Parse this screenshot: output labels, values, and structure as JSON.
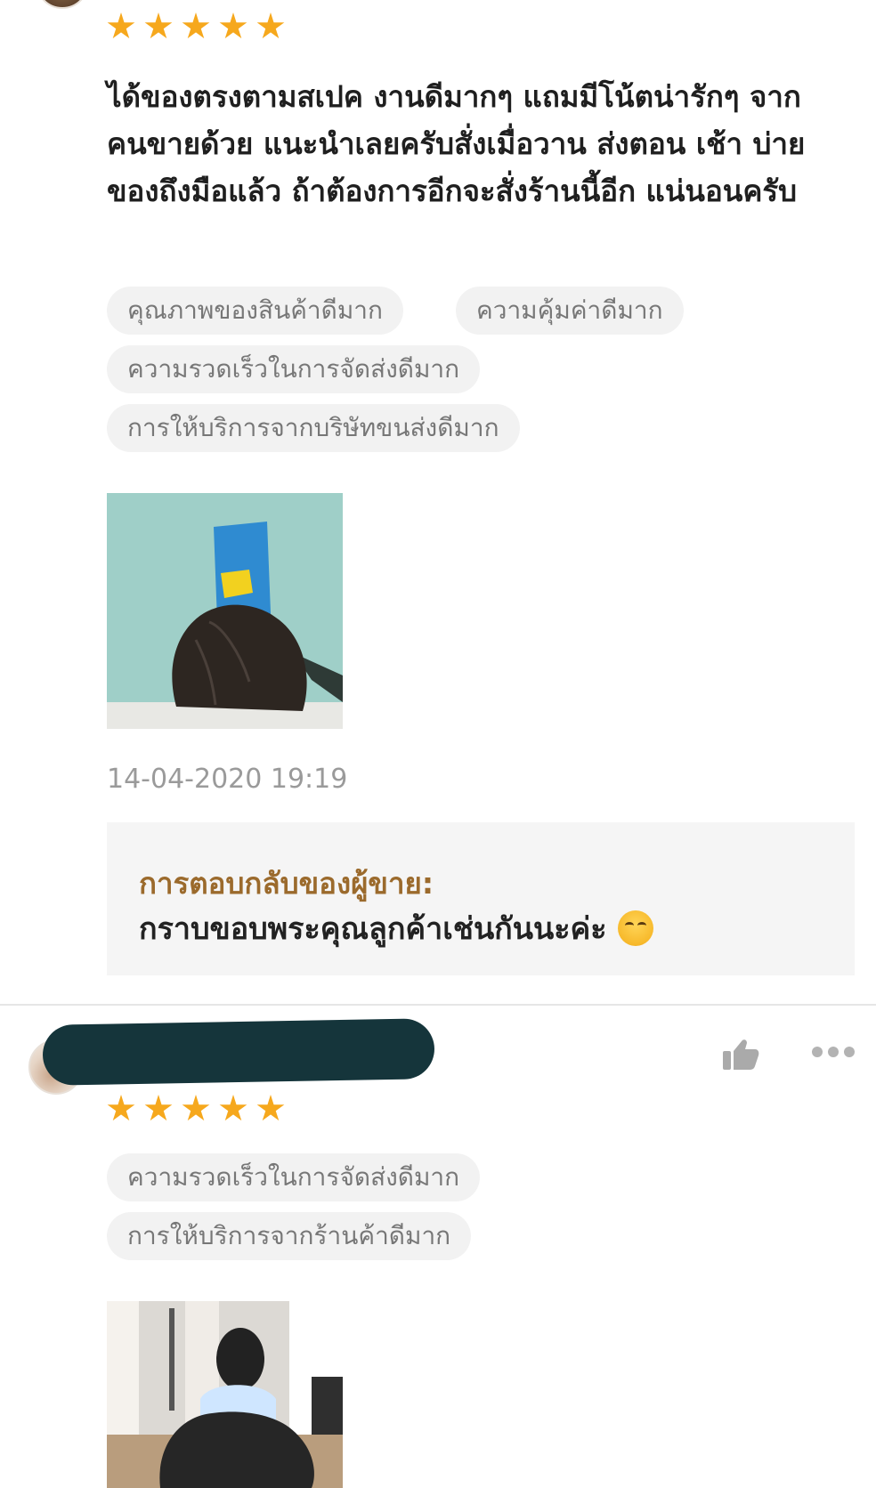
{
  "review1": {
    "rating": 5,
    "text": "ได้ของตรงตามสเปค งานดีมากๆ แถมมีโน้ตน่ารักๆ จากคนขายด้วย แนะนำเลยครับสั่งเมื่อวาน ส่งตอน เช้า บ่ายของถึงมือแล้ว ถ้าต้องการอีกจะสั่งร้านนี้อีก แน่นอนครับ",
    "tags": [
      "คุณภาพของสินค้าดีมาก",
      "ความคุ้มค่าดีมาก",
      "ความรวดเร็วในการจัดส่งดีมาก",
      "การให้บริการจากบริษัทขนส่งดีมาก"
    ],
    "timestamp": "14-04-2020 19:19",
    "seller_reply": {
      "title": "การตอบกลับของผู้ขาย:",
      "text": "กราบขอบพระคุณลูกค้าเช่นกันนะค่ะ"
    }
  },
  "review2": {
    "rating": 5,
    "tags": [
      "ความรวดเร็วในการจัดส่งดีมาก",
      "การให้บริการจากร้านค้าดีมาก"
    ]
  },
  "icons": {
    "star": "star-icon",
    "like": "thumbs-up-icon",
    "more": "more-horizontal-icon",
    "emoji": "smiling-face-emoji"
  },
  "colors": {
    "star": "#f6a81d",
    "seller_title": "#9b6a2c",
    "tag_background": "#f2f2f2",
    "tag_text": "#777777",
    "timestamp": "#9a9a9a"
  }
}
